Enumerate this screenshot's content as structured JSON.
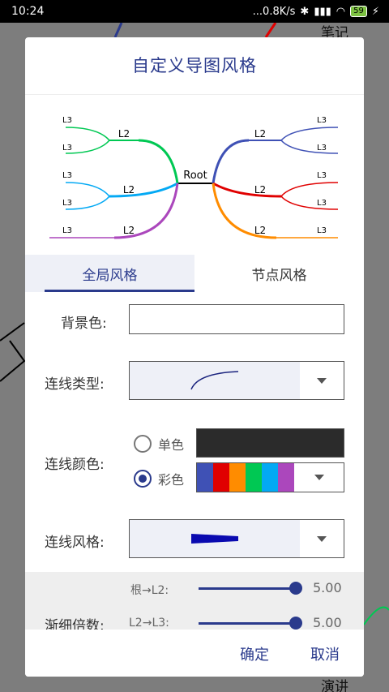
{
  "status_bar": {
    "time": "10:24",
    "network_speed": "...0.8K/s",
    "battery": "59"
  },
  "background": {
    "note_top": "笔记",
    "note_bottom": "演讲"
  },
  "dialog": {
    "title": "自定义导图风格",
    "preview": {
      "root": "Root",
      "l2": "L2",
      "l3": "L3"
    },
    "tabs": [
      {
        "label": "全局风格",
        "active": true
      },
      {
        "label": "节点风格",
        "active": false
      }
    ],
    "labels": {
      "background_color": "背景色:",
      "line_type": "连线类型:",
      "line_color": "连线颜色:",
      "line_style": "连线风格:",
      "taper_ratio": "渐细倍数:"
    },
    "line_color_options": {
      "single": "单色",
      "multi": "彩色",
      "selected": "multi",
      "single_color": "#2b2b2b",
      "multi_colors": [
        "#3f51b5",
        "#e00000",
        "#ff8c00",
        "#00c853",
        "#03a9f4",
        "#ab47bc"
      ]
    },
    "sliders": [
      {
        "label": "根→L2:",
        "value": "5.00",
        "fraction": 1.0
      },
      {
        "label": "L2→L3:",
        "value": "5.00",
        "fraction": 1.0
      }
    ],
    "buttons": {
      "confirm": "确定",
      "cancel": "取消"
    },
    "colors": {
      "accent": "#2a3a8c"
    }
  }
}
